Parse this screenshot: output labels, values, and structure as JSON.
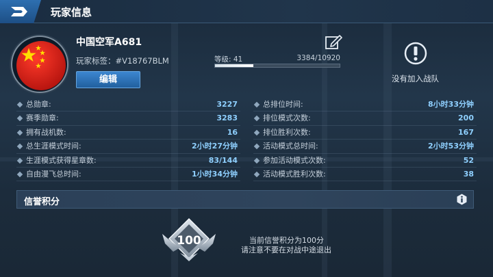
{
  "header": {
    "title": "玩家信息"
  },
  "profile": {
    "name": "中国空军A681",
    "tag": "玩家标签：#V18767BLM",
    "edit_label": "编辑",
    "level_label": "等级: 41",
    "xp_text": "3384/10920",
    "xp_progress": 0.31,
    "team_status": "没有加入战队"
  },
  "stats_left": [
    {
      "label": "总勋章:",
      "value": "3227"
    },
    {
      "label": "赛季勋章:",
      "value": "3283"
    },
    {
      "label": "拥有战机数:",
      "value": "16"
    },
    {
      "label": "总生涯模式时间:",
      "value": "2小时27分钟"
    },
    {
      "label": "生涯模式获得星章数:",
      "value": "83/144"
    },
    {
      "label": "自由漫飞总时间:",
      "value": "1小时34分钟"
    }
  ],
  "stats_right": [
    {
      "label": "总排位时间:",
      "value": "8小时33分钟"
    },
    {
      "label": "排位模式次数:",
      "value": "200"
    },
    {
      "label": "排位胜利次数:",
      "value": "167"
    },
    {
      "label": "活动模式总时间:",
      "value": "2小时53分钟"
    },
    {
      "label": "参加活动模式次数:",
      "value": "52"
    },
    {
      "label": "活动模式胜利次数:",
      "value": "38"
    }
  ],
  "honor": {
    "title": "信誉积分",
    "score": "100",
    "line1": "当前信誉积分为100分",
    "line2": "请注意不要在对战中途退出"
  },
  "colors": {
    "accent": "#2f7bc4",
    "value": "#8fd0ff",
    "flag_red": "#d8221c",
    "flag_star": "#ffde00"
  },
  "icons": [
    "logo-icon",
    "flag-icon",
    "edit-icon",
    "team-alert-icon",
    "info-icon",
    "honor-badge-icon"
  ]
}
